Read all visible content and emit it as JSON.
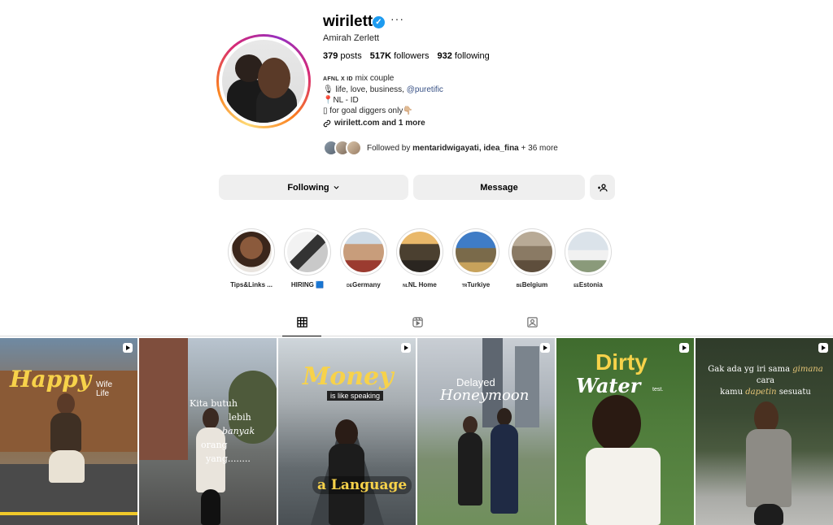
{
  "profile": {
    "username": "wirilett",
    "verified_mark": "✓",
    "more_label": "···",
    "full_name": "Amirah Zerlett",
    "stats": {
      "posts_count": "379",
      "posts_label": "posts",
      "followers_count": "517K",
      "followers_label": "followers",
      "following_count": "932",
      "following_label": "following"
    },
    "bio": {
      "line1_small": "AFNL X ID",
      "line1_rest": " mix couple",
      "line2_prefix": "🎙 life, love, business, ",
      "line2_mention": "@puretific",
      "line3": "📍NL - ID",
      "line4": "▯ for goal diggers only👇🏼",
      "url": "wirilett.com and 1 more"
    },
    "followed_by": {
      "prefix": "Followed by ",
      "names": "mentaridwigayati, idea_fina",
      "suffix": " + 36 more"
    }
  },
  "actions": {
    "following_label": "Following",
    "message_label": "Message",
    "add_user_icon": "add-user-icon"
  },
  "highlights": [
    {
      "label": "Tips&Links ...",
      "flag": ""
    },
    {
      "label": "HIRING 🟦",
      "flag": ""
    },
    {
      "label": "Germany",
      "flag": "DE"
    },
    {
      "label": "NL Home",
      "flag": "NL"
    },
    {
      "label": "Turkiye",
      "flag": "TR"
    },
    {
      "label": "Belgium",
      "flag": "BE"
    },
    {
      "label": "Estonia",
      "flag": "EE"
    }
  ],
  "tabs": [
    {
      "name": "posts",
      "icon": "grid-icon",
      "active": true
    },
    {
      "name": "reels",
      "icon": "reels-icon",
      "active": false
    },
    {
      "name": "tagged",
      "icon": "tagged-icon",
      "active": false
    }
  ],
  "posts": {
    "p1": {
      "title": "Happy",
      "sub1": "Wife",
      "sub2": "Life"
    },
    "p2": {
      "line1": "Kita butuh",
      "line2": "lebih",
      "line3": "banyak",
      "line4": "orang",
      "line5": "yang........"
    },
    "p3": {
      "title": "Money",
      "mid": "is like speaking",
      "bottom": "a Language"
    },
    "p4": {
      "line1": "Delayed",
      "line2": "Honeymoon"
    },
    "p5": {
      "line1": "Dirty",
      "line2": "Water",
      "line3": "test."
    },
    "p6": {
      "line1a": "Gak ada yg iri sama ",
      "line1b": "gimana",
      "line1c": " cara",
      "line2a": "kamu ",
      "line2b": "dapetin",
      "line2c": " sesuatu"
    }
  },
  "colors": {
    "accent_blue": "#1d9bf0",
    "link": "#385185",
    "button_bg": "#efefef",
    "border": "#dbdbdb"
  }
}
